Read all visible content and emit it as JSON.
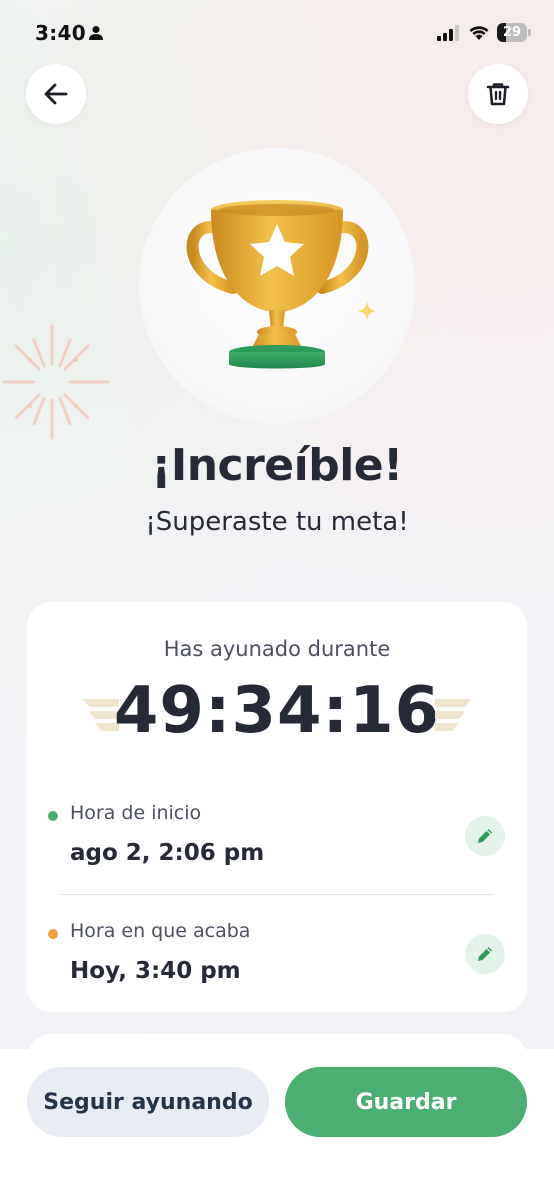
{
  "status_bar": {
    "time": "3:40",
    "battery_level": "29",
    "icons": [
      "person-icon",
      "signal-icon",
      "wifi-icon",
      "battery-icon"
    ]
  },
  "header": {
    "back_icon": "arrow-left-icon",
    "delete_icon": "trash-icon"
  },
  "hero": {
    "icon": "trophy-icon",
    "title": "¡Increíble!",
    "subtitle": "¡Superaste tu meta!"
  },
  "summary": {
    "label": "Has ayunado durante",
    "duration": "49:34:16",
    "start": {
      "label": "Hora de inicio",
      "value": "ago 2, 2:06 pm",
      "dot_color": "#4caf72"
    },
    "end": {
      "label": "Hora en que acaba",
      "value": "Hoy, 3:40 pm",
      "dot_color": "#f0a23c"
    }
  },
  "actions": {
    "continue_label": "Seguir ayunando",
    "save_label": "Guardar"
  },
  "colors": {
    "accent": "#4caf72",
    "text": "#262a36",
    "secondary_button": "#e8edf4"
  }
}
